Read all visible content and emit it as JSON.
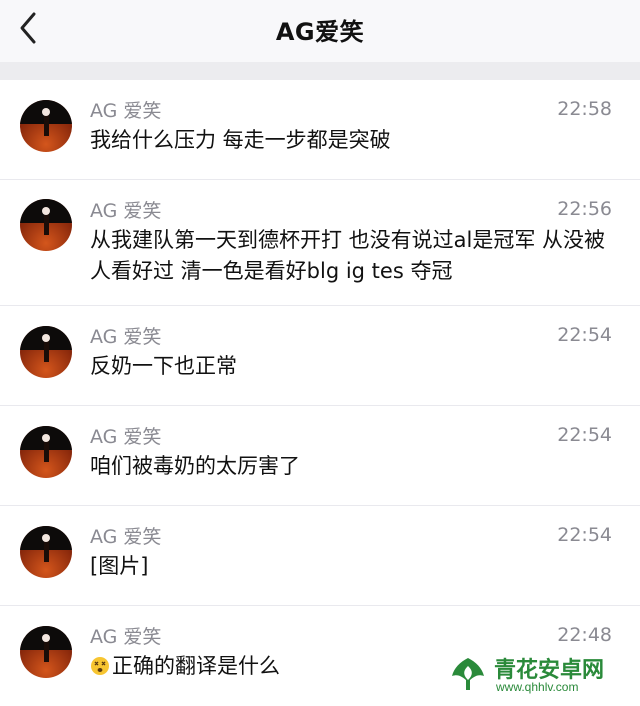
{
  "header": {
    "title": "AG爱笑"
  },
  "messages": [
    {
      "name": "AG 爱笑",
      "time": "22:58",
      "text": "我给什么压力 每走一步都是突破"
    },
    {
      "name": "AG 爱笑",
      "time": "22:56",
      "text": "从我建队第一天到德杯开打 也没有说过al是冠军 从没被人看好过 清一色是看好blg ig tes 夺冠"
    },
    {
      "name": "AG 爱笑",
      "time": "22:54",
      "text": "反奶一下也正常"
    },
    {
      "name": "AG 爱笑",
      "time": "22:54",
      "text": "咱们被毒奶的太厉害了"
    },
    {
      "name": "AG 爱笑",
      "time": "22:54",
      "text": "[图片]"
    },
    {
      "name": "AG 爱笑",
      "time": "22:48",
      "text": "正确的翻译是什么",
      "emoji": "dizzy-face-emoji"
    }
  ],
  "watermark": {
    "brand": "青花安卓网",
    "url": "www.qhhlv.com"
  },
  "colors": {
    "accent_green": "#2a8a3a",
    "avatar_red": "#b83a12"
  }
}
